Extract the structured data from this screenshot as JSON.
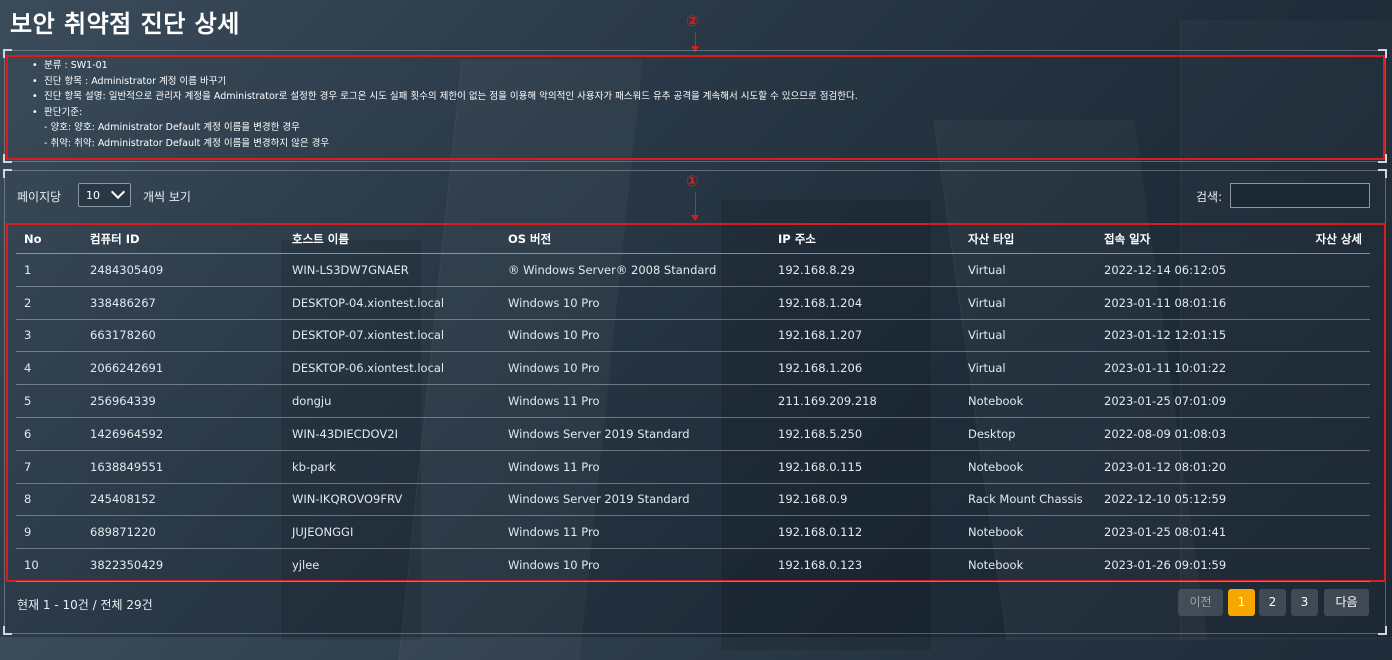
{
  "page": {
    "title": "보안 취약점 진단 상세"
  },
  "annotations": {
    "marker_1": "①",
    "marker_2": "②"
  },
  "info": {
    "category": "분류 : SW1-01",
    "item": "진단 항목 : Administrator 계정 이름 바꾸기",
    "description": "진단 항목 설명: 일반적으로 관리자 계정을 Administrator로 설정한 경우 로그온 시도 실패 횟수의 제한이 없는 점을 이용해 악의적인 사용자가 패스워드 유추 공격을 계속해서 시도할 수 있으므로 점검한다.",
    "criteria_title": "판단기준:",
    "criteria_good": "- 양호: 양호: Administrator Default 계정 이름을 변경한 경우",
    "criteria_bad": "- 취약: 취약: Administrator Default 계정 이름을 변경하지 않은 경우"
  },
  "controls": {
    "per_page_label": "페이지당",
    "per_page_value": "10",
    "per_page_suffix": "개씩 보기",
    "search_label": "검색:",
    "search_value": ""
  },
  "table": {
    "columns": [
      "No",
      "컴퓨터 ID",
      "호스트 이름",
      "OS 버전",
      "IP 주소",
      "자산 타입",
      "접속 일자",
      "자산 상세"
    ],
    "rows": [
      [
        "1",
        "2484305409",
        "WIN-LS3DW7GNAER",
        "® Windows Server® 2008 Standard",
        "192.168.8.29",
        "Virtual",
        "2022-12-14 06:12:05",
        ""
      ],
      [
        "2",
        "338486267",
        "DESKTOP-04.xiontest.local",
        "Windows 10 Pro",
        "192.168.1.204",
        "Virtual",
        "2023-01-11 08:01:16",
        ""
      ],
      [
        "3",
        "663178260",
        "DESKTOP-07.xiontest.local",
        "Windows 10 Pro",
        "192.168.1.207",
        "Virtual",
        "2023-01-12 12:01:15",
        ""
      ],
      [
        "4",
        "2066242691",
        "DESKTOP-06.xiontest.local",
        "Windows 10 Pro",
        "192.168.1.206",
        "Virtual",
        "2023-01-11 10:01:22",
        ""
      ],
      [
        "5",
        "256964339",
        "dongju",
        "Windows 11 Pro",
        "211.169.209.218",
        "Notebook",
        "2023-01-25 07:01:09",
        ""
      ],
      [
        "6",
        "1426964592",
        "WIN-43DIECDOV2I",
        "Windows Server 2019 Standard",
        "192.168.5.250",
        "Desktop",
        "2022-08-09 01:08:03",
        ""
      ],
      [
        "7",
        "1638849551",
        "kb-park",
        "Windows 11 Pro",
        "192.168.0.115",
        "Notebook",
        "2023-01-12 08:01:20",
        ""
      ],
      [
        "8",
        "245408152",
        "WIN-IKQROVO9FRV",
        "Windows Server 2019 Standard",
        "192.168.0.9",
        "Rack Mount Chassis",
        "2022-12-10 05:12:59",
        ""
      ],
      [
        "9",
        "689871220",
        "JUJEONGGI",
        "Windows 11 Pro",
        "192.168.0.112",
        "Notebook",
        "2023-01-25 08:01:41",
        ""
      ],
      [
        "10",
        "3822350429",
        "yjlee",
        "Windows 10 Pro",
        "192.168.0.123",
        "Notebook",
        "2023-01-26 09:01:59",
        ""
      ]
    ]
  },
  "footer": {
    "summary": "현재 1 - 10건 / 전체 29건",
    "prev_label": "이전",
    "pages": [
      "1",
      "2",
      "3"
    ],
    "active_page": "1",
    "next_label": "다음"
  },
  "colors": {
    "highlight_red": "#d91c1c",
    "active_page": "#f7a700"
  }
}
